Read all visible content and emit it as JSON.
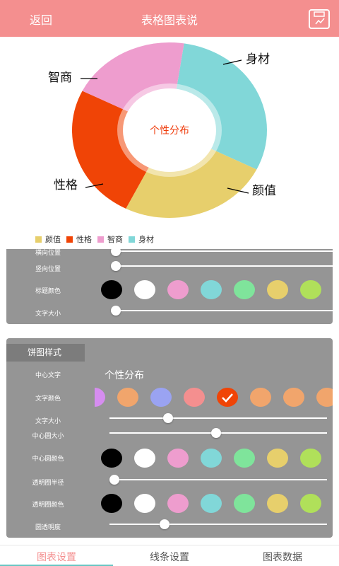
{
  "header": {
    "back_label": "返回",
    "title": "表格图表说",
    "save_icon": "save-chart-icon"
  },
  "colors": {
    "accent": "#f48f8f",
    "panel_bg": "#959595",
    "tab_indicator": "#66c6c3"
  },
  "chart_data": {
    "type": "pie",
    "center_label": "个性分布",
    "center_label_color": "#ef3b0b",
    "categories": [
      "颜值",
      "性格",
      "智商",
      "身材"
    ],
    "values": [
      25,
      25,
      20,
      30
    ],
    "colors": [
      "#e7cf6c",
      "#f04406",
      "#ee9dce",
      "#81d7d8"
    ],
    "legend_position": "bottom-left",
    "labels_outside": [
      "智商",
      "身材",
      "性格",
      "颜值"
    ]
  },
  "panel1": {
    "rows": [
      {
        "label": "横向位置",
        "value": 0
      },
      {
        "label": "竖向位置",
        "value": 0
      },
      {
        "label": "标题颜色",
        "swatches": [
          "#000000",
          "#ffffff",
          "#ee9dce",
          "#81d7d8",
          "#7fe49b",
          "#e7cf6c",
          "#b0e05a"
        ]
      },
      {
        "label": "文字大小",
        "value": 0
      }
    ]
  },
  "panel2": {
    "title": "饼图样式",
    "center_text_label": "中心文字",
    "center_text_value": "个性分布",
    "text_color_label": "文字颜色",
    "text_color_swatches": [
      "#d68df0",
      "#f1a56c",
      "#9aa3f2",
      "#f48f8f",
      "#f04406",
      "#f1a56c",
      "#f1a56c",
      "#f1a56c"
    ],
    "text_color_selected_index": 4,
    "text_size_label": "文字大小",
    "text_size_value": 0.26,
    "center_size_label": "中心圆大小",
    "center_size_value": 0.49,
    "center_color_label": "中心圆颜色",
    "center_color_swatches": [
      "#000000",
      "#ffffff",
      "#ee9dce",
      "#81d7d8",
      "#7fe49b",
      "#e7cf6c",
      "#b0e05a"
    ],
    "ring_radius_label": "透明圈半径",
    "ring_radius_value": 0,
    "ring_color_label": "透明圈颜色",
    "ring_color_swatches": [
      "#000000",
      "#ffffff",
      "#ee9dce",
      "#81d7d8",
      "#7fe49b",
      "#e7cf6c",
      "#b0e05a"
    ],
    "ring_alpha_label": "圆透明度",
    "ring_alpha_value": 0.24
  },
  "tabs": [
    {
      "label": "图表设置",
      "active": true
    },
    {
      "label": "线条设置",
      "active": false
    },
    {
      "label": "图表数据",
      "active": false
    }
  ]
}
